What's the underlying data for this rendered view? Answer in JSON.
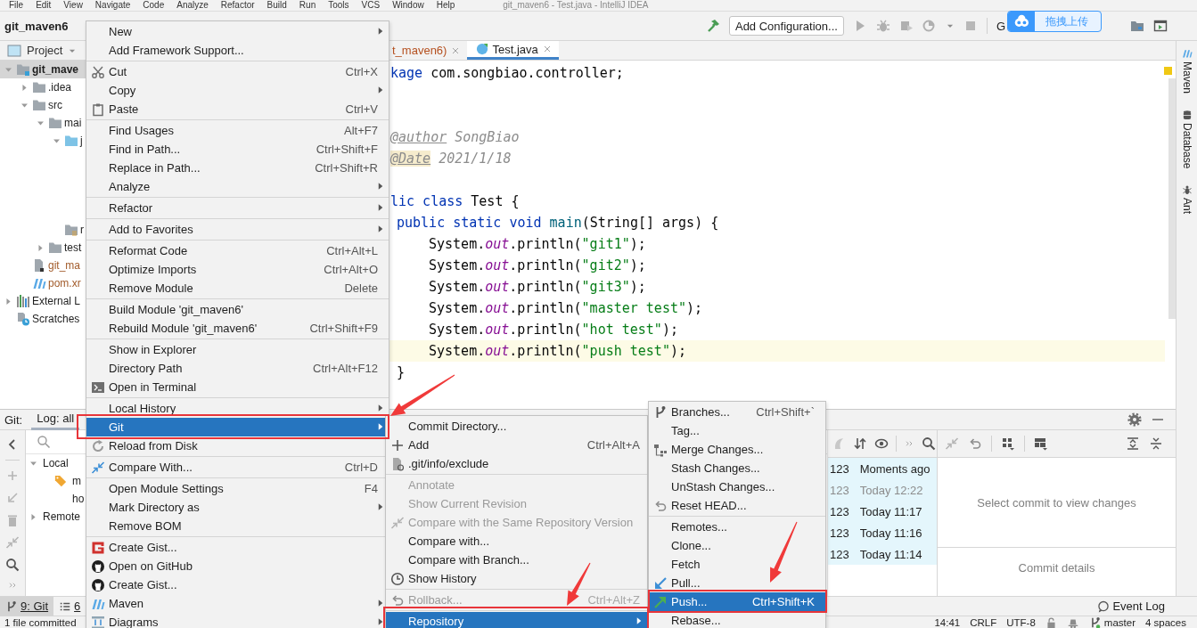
{
  "menubar": [
    "File",
    "Edit",
    "View",
    "Navigate",
    "Code",
    "Analyze",
    "Refactor",
    "Build",
    "Run",
    "Tools",
    "VCS",
    "Window",
    "Help"
  ],
  "title": "git_maven6 - Test.java - IntelliJ IDEA",
  "navbar": {
    "project": "git_maven6",
    "run_config": "Add Configuration...",
    "git_label": "G"
  },
  "upload_widget": {
    "label": "拖拽上传"
  },
  "project_panel": {
    "title": "Project",
    "tree": [
      {
        "label": "git_mave",
        "kind": "module",
        "expanded": true,
        "selected": true,
        "children": [
          {
            "label": ".idea",
            "kind": "folder",
            "expanded": false,
            "selected": false
          },
          {
            "label": "src",
            "kind": "folder",
            "expanded": true,
            "selected": false,
            "children": [
              {
                "label": "mai",
                "kind": "folder",
                "expanded": true,
                "selected": false,
                "children": [
                  {
                    "label": "j",
                    "kind": "source-folder",
                    "expanded": true,
                    "selected": false
                  },
                  {
                    "label": "r",
                    "kind": "resources-folder",
                    "selected": false
                  }
                ]
              },
              {
                "label": "test",
                "kind": "folder",
                "expanded": false,
                "selected": false
              }
            ]
          },
          {
            "label": "git_ma",
            "kind": "iml-file",
            "selected": false
          },
          {
            "label": "pom.xr",
            "kind": "maven-file",
            "selected": false
          }
        ]
      },
      {
        "label": "External L",
        "kind": "libraries",
        "expanded": false,
        "selected": false
      },
      {
        "label": "Scratches",
        "kind": "scratches",
        "selected": false
      }
    ]
  },
  "editor_tabs": [
    {
      "label": "t_maven6)",
      "kind": "module",
      "selected": false
    },
    {
      "label": "Test.java",
      "kind": "class",
      "selected": true
    }
  ],
  "code_lines": [
    {
      "kind": "top",
      "current": false,
      "tokens": [
        {
          "text": "kage",
          "kind": "keyword"
        },
        {
          "text": " com.songbiao.controller;",
          "kind": "plain"
        }
      ]
    },
    {
      "kind": "blank"
    },
    {
      "kind": "blank"
    },
    {
      "kind": "top",
      "current": false,
      "tokens": [
        {
          "text": "@author",
          "kind": "doc-tag"
        },
        {
          "text": " SongBiao",
          "kind": "doc"
        }
      ]
    },
    {
      "kind": "top",
      "current": false,
      "tokens": [
        {
          "text": "@Date",
          "kind": "doc-tag-marked"
        },
        {
          "text": " 2021/1/18",
          "kind": "doc"
        }
      ]
    },
    {
      "kind": "blank"
    },
    {
      "kind": "top",
      "current": false,
      "tokens": [
        {
          "text": "lic class",
          "kind": "keyword"
        },
        {
          "text": " Test {",
          "kind": "plain"
        }
      ]
    },
    {
      "kind": "member",
      "current": false,
      "tokens": [
        {
          "text": "public static void",
          "kind": "keyword"
        },
        {
          "text": " main",
          "kind": "method"
        },
        {
          "text": "(String[] args) {",
          "kind": "plain"
        }
      ]
    },
    {
      "kind": "statement",
      "current": false,
      "tokens": [
        {
          "text": "System.",
          "kind": "plain"
        },
        {
          "text": "out",
          "kind": "field"
        },
        {
          "text": ".println(",
          "kind": "plain"
        },
        {
          "text": "\"git1\"",
          "kind": "string"
        },
        {
          "text": ");",
          "kind": "plain"
        }
      ]
    },
    {
      "kind": "statement",
      "current": false,
      "tokens": [
        {
          "text": "System.",
          "kind": "plain"
        },
        {
          "text": "out",
          "kind": "field"
        },
        {
          "text": ".println(",
          "kind": "plain"
        },
        {
          "text": "\"git2\"",
          "kind": "string"
        },
        {
          "text": ");",
          "kind": "plain"
        }
      ]
    },
    {
      "kind": "statement",
      "current": false,
      "tokens": [
        {
          "text": "System.",
          "kind": "plain"
        },
        {
          "text": "out",
          "kind": "field"
        },
        {
          "text": ".println(",
          "kind": "plain"
        },
        {
          "text": "\"git3\"",
          "kind": "string"
        },
        {
          "text": ");",
          "kind": "plain"
        }
      ]
    },
    {
      "kind": "statement",
      "current": false,
      "tokens": [
        {
          "text": "System.",
          "kind": "plain"
        },
        {
          "text": "out",
          "kind": "field"
        },
        {
          "text": ".println(",
          "kind": "plain"
        },
        {
          "text": "\"master test\"",
          "kind": "string"
        },
        {
          "text": ");",
          "kind": "plain"
        }
      ]
    },
    {
      "kind": "statement",
      "current": false,
      "tokens": [
        {
          "text": "System.",
          "kind": "plain"
        },
        {
          "text": "out",
          "kind": "field"
        },
        {
          "text": ".println(",
          "kind": "plain"
        },
        {
          "text": "\"hot test\"",
          "kind": "string"
        },
        {
          "text": ");",
          "kind": "plain"
        }
      ]
    },
    {
      "kind": "statement",
      "current": true,
      "tokens": [
        {
          "text": "System.",
          "kind": "plain"
        },
        {
          "text": "out",
          "kind": "field"
        },
        {
          "text": ".println(",
          "kind": "plain"
        },
        {
          "text": "\"push test\"",
          "kind": "string"
        },
        {
          "text": ");",
          "kind": "plain"
        }
      ]
    },
    {
      "kind": "member",
      "current": false,
      "tokens": [
        {
          "text": "}",
          "kind": "plain"
        }
      ]
    }
  ],
  "right_stripe": [
    {
      "label": "Maven",
      "kind": "maven"
    },
    {
      "label": "Database",
      "kind": "database"
    },
    {
      "label": "Ant",
      "kind": "ant"
    }
  ],
  "git_panel": {
    "label": "Git:",
    "tabs": [
      {
        "label": "Log: all",
        "selected": true
      }
    ],
    "branches": [
      {
        "label": "Local",
        "expanded": true,
        "selected": false,
        "children": [
          {
            "label": "m",
            "kind": "current",
            "selected": false
          },
          {
            "label": "ho",
            "kind": "branch",
            "selected": false
          }
        ]
      },
      {
        "label": "Remote",
        "expanded": false,
        "selected": false
      }
    ],
    "commits": [
      {
        "author": "123",
        "date": "Moments ago",
        "dimmed": false
      },
      {
        "author": "123",
        "date": "Today 12:22",
        "dimmed": true
      },
      {
        "author": "123",
        "date": "Today 11:17",
        "dimmed": false
      },
      {
        "author": "123",
        "date": "Today 11:16",
        "dimmed": false
      },
      {
        "author": "123",
        "date": "Today 11:14",
        "dimmed": false
      }
    ],
    "changes_hint": "Select commit to view changes",
    "details_hint": "Commit details"
  },
  "bottom_tabs": [
    {
      "label": "9: Git",
      "kind": "branch",
      "selected": true
    },
    {
      "label": "6",
      "kind": "list",
      "selected": false
    }
  ],
  "event_log": "Event Log",
  "status_bar": {
    "message": "1 file committed",
    "position": "14:41",
    "line_separator": "CRLF",
    "encoding": "UTF-8",
    "branch": "master",
    "indent": "4 spaces"
  },
  "menus": [
    {
      "sections": [
        [
          {
            "label": "New",
            "submenu": true,
            "selected": false
          },
          {
            "label": "Add Framework Support...",
            "submenu": false,
            "selected": false
          }
        ],
        [
          {
            "label": "Cut",
            "kind": "scissors",
            "shortcut": "Ctrl+X",
            "submenu": false,
            "selected": false
          },
          {
            "label": "Copy",
            "submenu": true,
            "selected": false
          },
          {
            "label": "Paste",
            "kind": "clipboard",
            "shortcut": "Ctrl+V",
            "submenu": false,
            "selected": false
          }
        ],
        [
          {
            "label": "Find Usages",
            "shortcut": "Alt+F7",
            "submenu": false,
            "selected": false
          },
          {
            "label": "Find in Path...",
            "shortcut": "Ctrl+Shift+F",
            "submenu": false,
            "selected": false
          },
          {
            "label": "Replace in Path...",
            "shortcut": "Ctrl+Shift+R",
            "submenu": false,
            "selected": false
          },
          {
            "label": "Analyze",
            "submenu": true,
            "selected": false
          }
        ],
        [
          {
            "label": "Refactor",
            "submenu": true,
            "selected": false
          }
        ],
        [
          {
            "label": "Add to Favorites",
            "submenu": true,
            "selected": false
          }
        ],
        [
          {
            "label": "Reformat Code",
            "shortcut": "Ctrl+Alt+L",
            "submenu": false,
            "selected": false
          },
          {
            "label": "Optimize Imports",
            "shortcut": "Ctrl+Alt+O",
            "submenu": false,
            "selected": false
          },
          {
            "label": "Remove Module",
            "shortcut": "Delete",
            "submenu": false,
            "selected": false
          }
        ],
        [
          {
            "label": "Build Module 'git_maven6'",
            "submenu": false,
            "selected": false
          },
          {
            "label": "Rebuild Module 'git_maven6'",
            "shortcut": "Ctrl+Shift+F9",
            "submenu": false,
            "selected": false
          }
        ],
        [
          {
            "label": "Show in Explorer",
            "submenu": false,
            "selected": false
          },
          {
            "label": "Directory Path",
            "shortcut": "Ctrl+Alt+F12",
            "submenu": false,
            "selected": false
          },
          {
            "label": "Open in Terminal",
            "kind": "terminal",
            "submenu": false,
            "selected": false
          }
        ],
        [
          {
            "label": "Local History",
            "submenu": true,
            "selected": false
          },
          {
            "label": "Git",
            "submenu": true,
            "selected": true
          },
          {
            "label": "Reload from Disk",
            "kind": "refresh",
            "submenu": false,
            "selected": false
          }
        ],
        [
          {
            "label": "Compare With...",
            "kind": "compare",
            "shortcut": "Ctrl+D",
            "submenu": false,
            "selected": false
          }
        ],
        [
          {
            "label": "Open Module Settings",
            "shortcut": "F4",
            "submenu": false,
            "selected": false
          },
          {
            "label": "Mark Directory as",
            "submenu": true,
            "selected": false
          },
          {
            "label": "Remove BOM",
            "submenu": false,
            "selected": false
          }
        ],
        [
          {
            "label": "Create Gist...",
            "kind": "gist",
            "submenu": false,
            "selected": false
          },
          {
            "label": "Open on GitHub",
            "kind": "github",
            "submenu": false,
            "selected": false
          },
          {
            "label": "Create Gist...",
            "kind": "github",
            "submenu": false,
            "selected": false
          },
          {
            "label": "Maven",
            "kind": "maven",
            "submenu": true,
            "selected": false
          },
          {
            "label": "Diagrams",
            "kind": "diagrams",
            "submenu": true,
            "selected": false
          }
        ]
      ]
    },
    {
      "sections": [
        [
          {
            "label": "Commit Directory...",
            "disabled": false,
            "submenu": false,
            "selected": false
          },
          {
            "label": "Add",
            "kind": "plus",
            "shortcut": "Ctrl+Alt+A",
            "disabled": false,
            "submenu": false,
            "selected": false
          },
          {
            "label": ".git/info/exclude",
            "kind": "file",
            "disabled": false,
            "submenu": false,
            "selected": false
          }
        ],
        [
          {
            "label": "Annotate",
            "disabled": true,
            "submenu": false,
            "selected": false
          },
          {
            "label": "Show Current Revision",
            "disabled": true,
            "submenu": false,
            "selected": false
          },
          {
            "label": "Compare with the Same Repository Version",
            "kind": "compare-off",
            "disabled": true,
            "submenu": false,
            "selected": false
          },
          {
            "label": "Compare with...",
            "disabled": false,
            "submenu": false,
            "selected": false
          },
          {
            "label": "Compare with Branch...",
            "disabled": false,
            "submenu": false,
            "selected": false
          },
          {
            "label": "Show History",
            "kind": "clock",
            "disabled": false,
            "submenu": false,
            "selected": false
          }
        ],
        [
          {
            "label": "Rollback...",
            "kind": "undo",
            "shortcut": "Ctrl+Alt+Z",
            "disabled": true,
            "submenu": false,
            "selected": false
          }
        ],
        [
          {
            "label": "Repository",
            "disabled": false,
            "submenu": true,
            "selected": true
          }
        ]
      ]
    },
    {
      "sections": [
        [
          {
            "label": "Branches...",
            "kind": "branch",
            "shortcut": "Ctrl+Shift+`",
            "submenu": false,
            "selected": false
          },
          {
            "label": "Tag...",
            "submenu": false,
            "selected": false
          },
          {
            "label": "Merge Changes...",
            "kind": "merge",
            "submenu": false,
            "selected": false
          },
          {
            "label": "Stash Changes...",
            "submenu": false,
            "selected": false
          },
          {
            "label": "UnStash Changes...",
            "submenu": false,
            "selected": false
          },
          {
            "label": "Reset HEAD...",
            "kind": "undo",
            "submenu": false,
            "selected": false
          }
        ],
        [
          {
            "label": "Remotes...",
            "submenu": false,
            "selected": false
          },
          {
            "label": "Clone...",
            "submenu": false,
            "selected": false
          },
          {
            "label": "Fetch",
            "submenu": false,
            "selected": false
          },
          {
            "label": "Pull...",
            "kind": "pull",
            "submenu": false,
            "selected": false
          },
          {
            "label": "Push...",
            "kind": "push",
            "shortcut": "Ctrl+Shift+K",
            "submenu": false,
            "selected": true
          },
          {
            "label": "Rebase...",
            "submenu": false,
            "selected": false
          }
        ]
      ]
    }
  ]
}
